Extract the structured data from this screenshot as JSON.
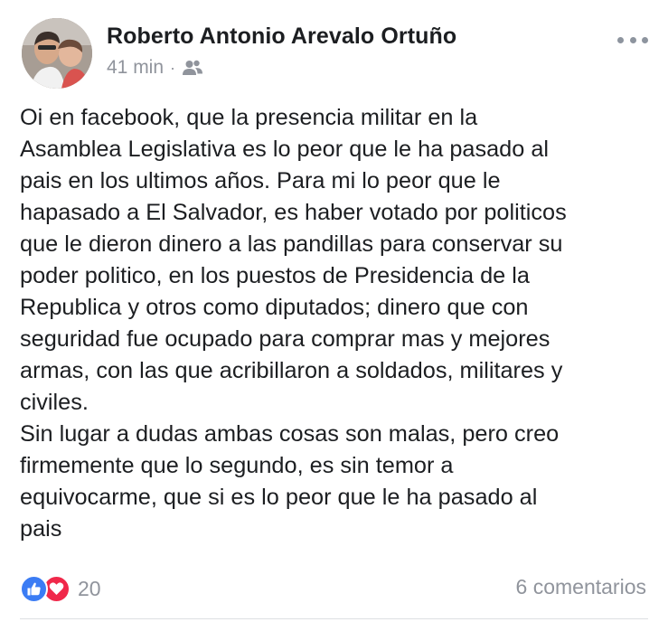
{
  "post": {
    "author_name": "Roberto Antonio Arevalo Ortuño",
    "timestamp": "41 min",
    "separator": "·",
    "privacy_icon": "friends-icon",
    "more_icon": "more-options-icon",
    "body": "Oi en facebook, que la presencia militar en la\nAsamblea Legislativa es lo peor que le ha pasado al\npais en los ultimos años. Para mi lo peor que le\nhapasado a El Salvador, es haber votado por politicos\nque le dieron dinero a las pandillas para conservar su\npoder politico, en los puestos de Presidencia de la\nRepublica y otros como diputados; dinero que con\nseguridad fue ocupado para comprar mas y mejores\narmas, con las que acribillaron a soldados, militares y\nciviles.\nSin lugar a dudas ambas cosas son malas, pero creo\nfirmemente que lo segundo, es sin temor a\nequivocarme, que si es lo peor que le ha pasado al\npais"
  },
  "footer": {
    "reaction_icons": [
      "like-icon",
      "love-icon"
    ],
    "reaction_count": "20",
    "comments": "6 comentarios"
  },
  "colors": {
    "text": "#1c1e21",
    "secondary_text": "#90949c",
    "like_blue": "#3b7cf4",
    "love_red": "#f0284a"
  }
}
